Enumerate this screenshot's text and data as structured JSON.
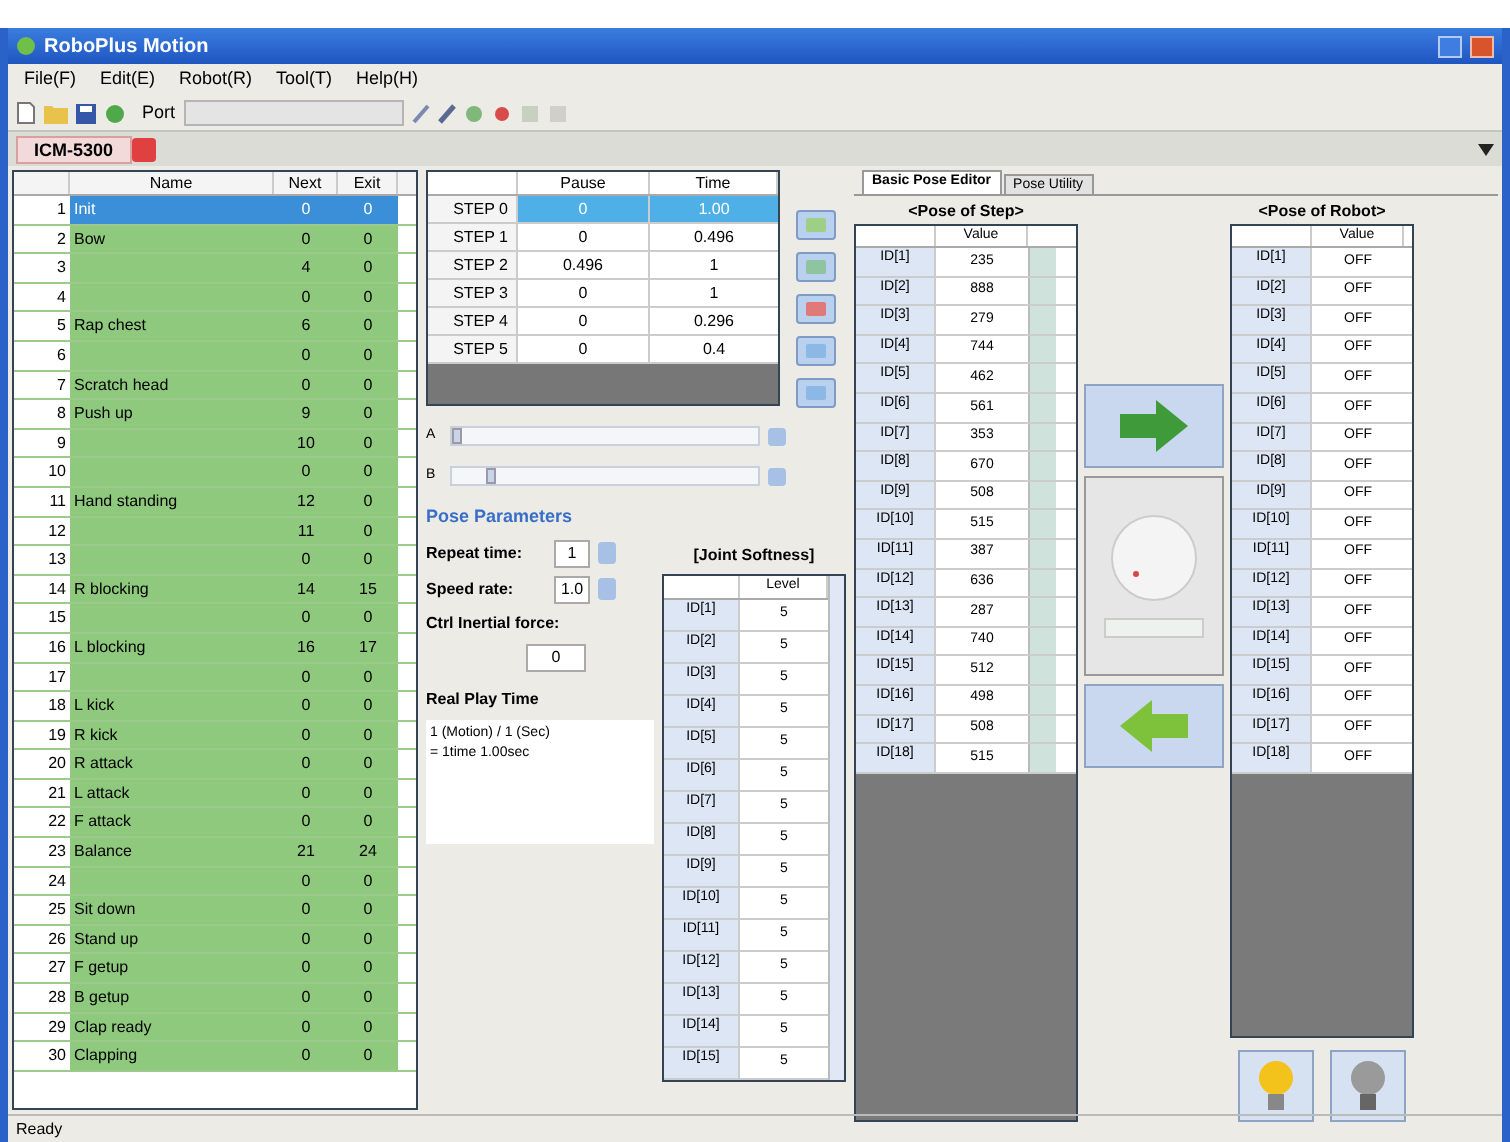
{
  "window": {
    "title": "RoboPlus Motion"
  },
  "menu": [
    "File(F)",
    "Edit(E)",
    "Robot(R)",
    "Tool(T)",
    "Help(H)"
  ],
  "toolbar": {
    "port_label": "Port"
  },
  "document_tab": {
    "label": "ICM-5300"
  },
  "motions": {
    "columns": [
      "",
      "Name",
      "Next",
      "Exit"
    ],
    "rows": [
      {
        "num": "1",
        "name": "Init",
        "next": "0",
        "exit": "0",
        "selected": true
      },
      {
        "num": "2",
        "name": "Bow",
        "next": "0",
        "exit": "0",
        "selected": false
      },
      {
        "num": "3",
        "name": "",
        "next": "4",
        "exit": "0",
        "selected": false
      },
      {
        "num": "4",
        "name": "",
        "next": "0",
        "exit": "0",
        "selected": false
      },
      {
        "num": "5",
        "name": "Rap chest",
        "next": "6",
        "exit": "0",
        "selected": false
      },
      {
        "num": "6",
        "name": "",
        "next": "0",
        "exit": "0",
        "selected": false
      },
      {
        "num": "7",
        "name": "Scratch head",
        "next": "0",
        "exit": "0",
        "selected": false
      },
      {
        "num": "8",
        "name": "Push up",
        "next": "9",
        "exit": "0",
        "selected": false
      },
      {
        "num": "9",
        "name": "",
        "next": "10",
        "exit": "0",
        "selected": false
      },
      {
        "num": "10",
        "name": "",
        "next": "0",
        "exit": "0",
        "selected": false
      },
      {
        "num": "11",
        "name": "Hand standing",
        "next": "12",
        "exit": "0",
        "selected": false
      },
      {
        "num": "12",
        "name": "",
        "next": "11",
        "exit": "0",
        "selected": false
      },
      {
        "num": "13",
        "name": "",
        "next": "0",
        "exit": "0",
        "selected": false
      },
      {
        "num": "14",
        "name": "R blocking",
        "next": "14",
        "exit": "15",
        "selected": false
      },
      {
        "num": "15",
        "name": "",
        "next": "0",
        "exit": "0",
        "selected": false
      },
      {
        "num": "16",
        "name": "L blocking",
        "next": "16",
        "exit": "17",
        "selected": false
      },
      {
        "num": "17",
        "name": "",
        "next": "0",
        "exit": "0",
        "selected": false
      },
      {
        "num": "18",
        "name": "L kick",
        "next": "0",
        "exit": "0",
        "selected": false
      },
      {
        "num": "19",
        "name": "R kick",
        "next": "0",
        "exit": "0",
        "selected": false
      },
      {
        "num": "20",
        "name": "R attack",
        "next": "0",
        "exit": "0",
        "selected": false
      },
      {
        "num": "21",
        "name": "L attack",
        "next": "0",
        "exit": "0",
        "selected": false
      },
      {
        "num": "22",
        "name": "F attack",
        "next": "0",
        "exit": "0",
        "selected": false
      },
      {
        "num": "23",
        "name": "Balance",
        "next": "21",
        "exit": "24",
        "selected": false
      },
      {
        "num": "24",
        "name": "",
        "next": "0",
        "exit": "0",
        "selected": false
      },
      {
        "num": "25",
        "name": "Sit down",
        "next": "0",
        "exit": "0",
        "selected": false
      },
      {
        "num": "26",
        "name": "Stand up",
        "next": "0",
        "exit": "0",
        "selected": false
      },
      {
        "num": "27",
        "name": "F getup",
        "next": "0",
        "exit": "0",
        "selected": false
      },
      {
        "num": "28",
        "name": "B getup",
        "next": "0",
        "exit": "0",
        "selected": false
      },
      {
        "num": "29",
        "name": "Clap ready",
        "next": "0",
        "exit": "0",
        "selected": false
      },
      {
        "num": "30",
        "name": "Clapping",
        "next": "0",
        "exit": "0",
        "selected": false
      }
    ]
  },
  "steps": {
    "columns": [
      "",
      "Pause",
      "Time"
    ],
    "rows": [
      {
        "label": "STEP 0",
        "pause": "0",
        "time": "1.00",
        "selected": true
      },
      {
        "label": "STEP 1",
        "pause": "0",
        "time": "0.496",
        "selected": false
      },
      {
        "label": "STEP 2",
        "pause": "0.496",
        "time": "1",
        "selected": false
      },
      {
        "label": "STEP 3",
        "pause": "0",
        "time": "1",
        "selected": false
      },
      {
        "label": "STEP 4",
        "pause": "0",
        "time": "0.296",
        "selected": false
      },
      {
        "label": "STEP 5",
        "pause": "0",
        "time": "0.4",
        "selected": false
      }
    ]
  },
  "sliders": [
    {
      "label": "A",
      "level": 0
    },
    {
      "label": "B",
      "level": 0.12
    }
  ],
  "pose_parameters": {
    "title": "Pose Parameters",
    "repeat_label": "Repeat time:",
    "repeat_value": "1",
    "speed_label": "Speed rate:",
    "speed_value": "1.0",
    "inertial_label": "Ctrl Inertial force:",
    "inertial_value": "0",
    "real_play_title": "Real Play Time",
    "real_play_lines": [
      "1 (Motion) / 1 (Sec)",
      "= 1time 1.00sec"
    ]
  },
  "joint_softness": {
    "title": "[Joint Softness]",
    "columns": [
      "",
      "Level"
    ],
    "rows": [
      {
        "id": "ID[1]",
        "level": "5"
      },
      {
        "id": "ID[2]",
        "level": "5"
      },
      {
        "id": "ID[3]",
        "level": "5"
      },
      {
        "id": "ID[4]",
        "level": "5"
      },
      {
        "id": "ID[5]",
        "level": "5"
      },
      {
        "id": "ID[6]",
        "level": "5"
      },
      {
        "id": "ID[7]",
        "level": "5"
      },
      {
        "id": "ID[8]",
        "level": "5"
      },
      {
        "id": "ID[9]",
        "level": "5"
      },
      {
        "id": "ID[10]",
        "level": "5"
      },
      {
        "id": "ID[11]",
        "level": "5"
      },
      {
        "id": "ID[12]",
        "level": "5"
      },
      {
        "id": "ID[13]",
        "level": "5"
      },
      {
        "id": "ID[14]",
        "level": "5"
      },
      {
        "id": "ID[15]",
        "level": "5"
      }
    ]
  },
  "right_tabs": [
    {
      "label": "Basic Pose Editor",
      "selected": true
    },
    {
      "label": "Pose Utility",
      "selected": false
    }
  ],
  "pose_of_step": {
    "title": "<Pose of Step>",
    "columns": [
      "",
      "Value"
    ],
    "rows": [
      {
        "id": "ID[1]",
        "value": "235"
      },
      {
        "id": "ID[2]",
        "value": "888"
      },
      {
        "id": "ID[3]",
        "value": "279"
      },
      {
        "id": "ID[4]",
        "value": "744"
      },
      {
        "id": "ID[5]",
        "value": "462"
      },
      {
        "id": "ID[6]",
        "value": "561"
      },
      {
        "id": "ID[7]",
        "value": "353"
      },
      {
        "id": "ID[8]",
        "value": "670"
      },
      {
        "id": "ID[9]",
        "value": "508"
      },
      {
        "id": "ID[10]",
        "value": "515"
      },
      {
        "id": "ID[11]",
        "value": "387"
      },
      {
        "id": "ID[12]",
        "value": "636"
      },
      {
        "id": "ID[13]",
        "value": "287"
      },
      {
        "id": "ID[14]",
        "value": "740"
      },
      {
        "id": "ID[15]",
        "value": "512"
      },
      {
        "id": "ID[16]",
        "value": "498"
      },
      {
        "id": "ID[17]",
        "value": "508"
      },
      {
        "id": "ID[18]",
        "value": "515"
      }
    ]
  },
  "pose_of_robot": {
    "title": "<Pose of Robot>",
    "columns": [
      "",
      "Value"
    ],
    "rows": [
      {
        "id": "ID[1]",
        "value": "OFF"
      },
      {
        "id": "ID[2]",
        "value": "OFF"
      },
      {
        "id": "ID[3]",
        "value": "OFF"
      },
      {
        "id": "ID[4]",
        "value": "OFF"
      },
      {
        "id": "ID[5]",
        "value": "OFF"
      },
      {
        "id": "ID[6]",
        "value": "OFF"
      },
      {
        "id": "ID[7]",
        "value": "OFF"
      },
      {
        "id": "ID[8]",
        "value": "OFF"
      },
      {
        "id": "ID[9]",
        "value": "OFF"
      },
      {
        "id": "ID[10]",
        "value": "OFF"
      },
      {
        "id": "ID[11]",
        "value": "OFF"
      },
      {
        "id": "ID[12]",
        "value": "OFF"
      },
      {
        "id": "ID[13]",
        "value": "OFF"
      },
      {
        "id": "ID[14]",
        "value": "OFF"
      },
      {
        "id": "ID[15]",
        "value": "OFF"
      },
      {
        "id": "ID[16]",
        "value": "OFF"
      },
      {
        "id": "ID[17]",
        "value": "OFF"
      },
      {
        "id": "ID[18]",
        "value": "OFF"
      }
    ]
  },
  "status_bar": "Ready"
}
